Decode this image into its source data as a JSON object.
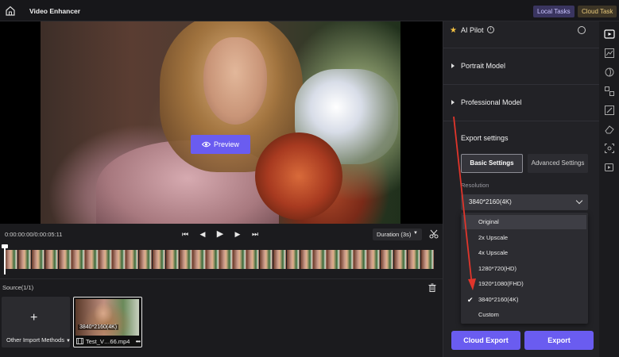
{
  "header": {
    "title": "Video Enhancer",
    "local_tasks": "Local Tasks",
    "cloud_task": "Cloud Task"
  },
  "preview": {
    "button_label": "Preview"
  },
  "player": {
    "timecode": "0:00:00:00/0:00:05:11",
    "duration_select": "Duration (3s)"
  },
  "source": {
    "title": "Source(1/1)",
    "import_label": "Other Import Methods",
    "media": {
      "resolution": "3840*2160(4K)",
      "filename": "Test_V…66.mp4",
      "more": "•••"
    }
  },
  "settings": {
    "ai_pilot": "AI Pilot",
    "portrait_model": "Portrait Model",
    "professional_model": "Professional Model",
    "export_settings": "Export settings",
    "basic_tab": "Basic Settings",
    "advanced_tab": "Advanced Settings",
    "resolution_label": "Resolution",
    "resolution_selected": "3840*2160(4K)",
    "resolution_options": [
      "Original",
      "2x Upscale",
      "4x Upscale",
      "1280*720(HD)",
      "1920*1080(FHD)",
      "3840*2160(4K)",
      "Custom"
    ],
    "cloud_export": "Cloud Export",
    "export": "Export"
  },
  "colors": {
    "accent": "#6a5cf0",
    "annotation": "#e0352b"
  }
}
